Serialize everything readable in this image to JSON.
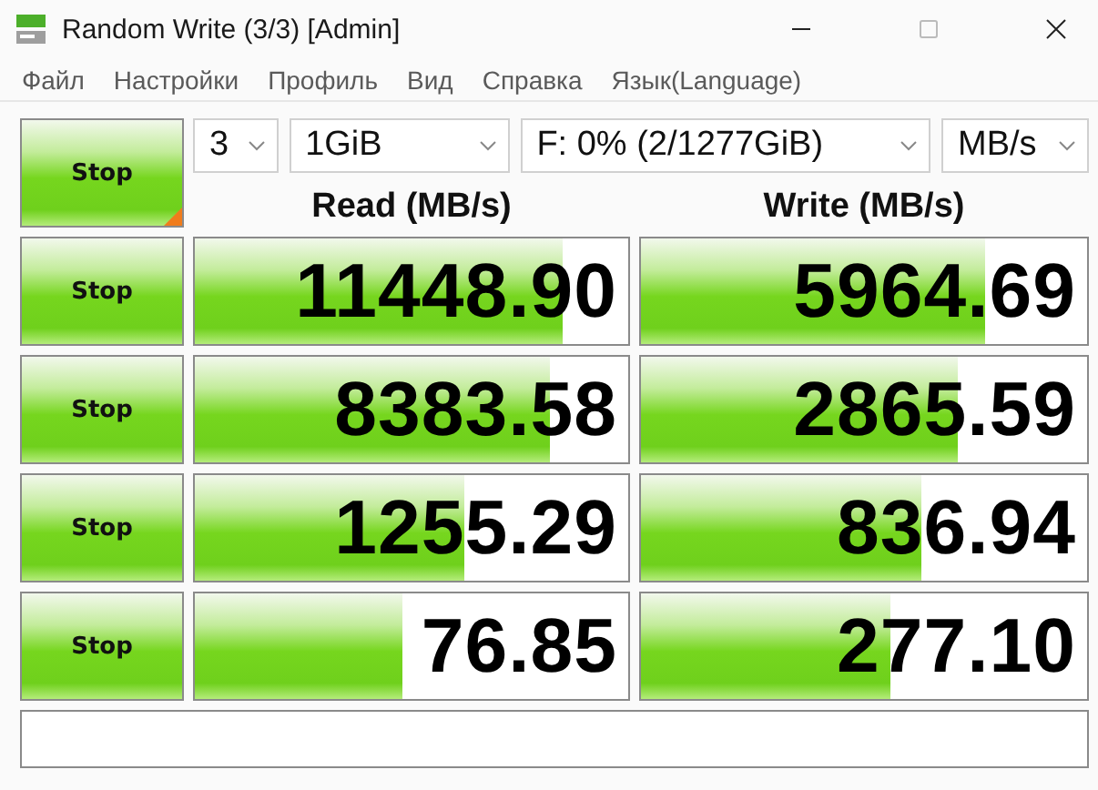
{
  "window": {
    "title": "Random Write (3/3) [Admin]"
  },
  "menu": [
    "Файл",
    "Настройки",
    "Профиль",
    "Вид",
    "Справка",
    "Язык(Language)"
  ],
  "controls": {
    "main_button": "Stop",
    "count": "3",
    "size": "1GiB",
    "drive": "F: 0% (2/1277GiB)",
    "unit": "MB/s"
  },
  "headers": {
    "read": "Read (MB/s)",
    "write": "Write (MB/s)"
  },
  "rows": [
    {
      "button": "Stop",
      "read": {
        "value": "11448.90",
        "level": 0.85
      },
      "write": {
        "value": "5964.69",
        "level": 0.77
      }
    },
    {
      "button": "Stop",
      "read": {
        "value": "8383.58",
        "level": 0.82
      },
      "write": {
        "value": "2865.59",
        "level": 0.71
      }
    },
    {
      "button": "Stop",
      "read": {
        "value": "1255.29",
        "level": 0.62
      },
      "write": {
        "value": "836.94",
        "level": 0.63
      }
    },
    {
      "button": "Stop",
      "read": {
        "value": "76.85",
        "level": 0.48
      },
      "write": {
        "value": "277.10",
        "level": 0.56
      }
    }
  ]
}
